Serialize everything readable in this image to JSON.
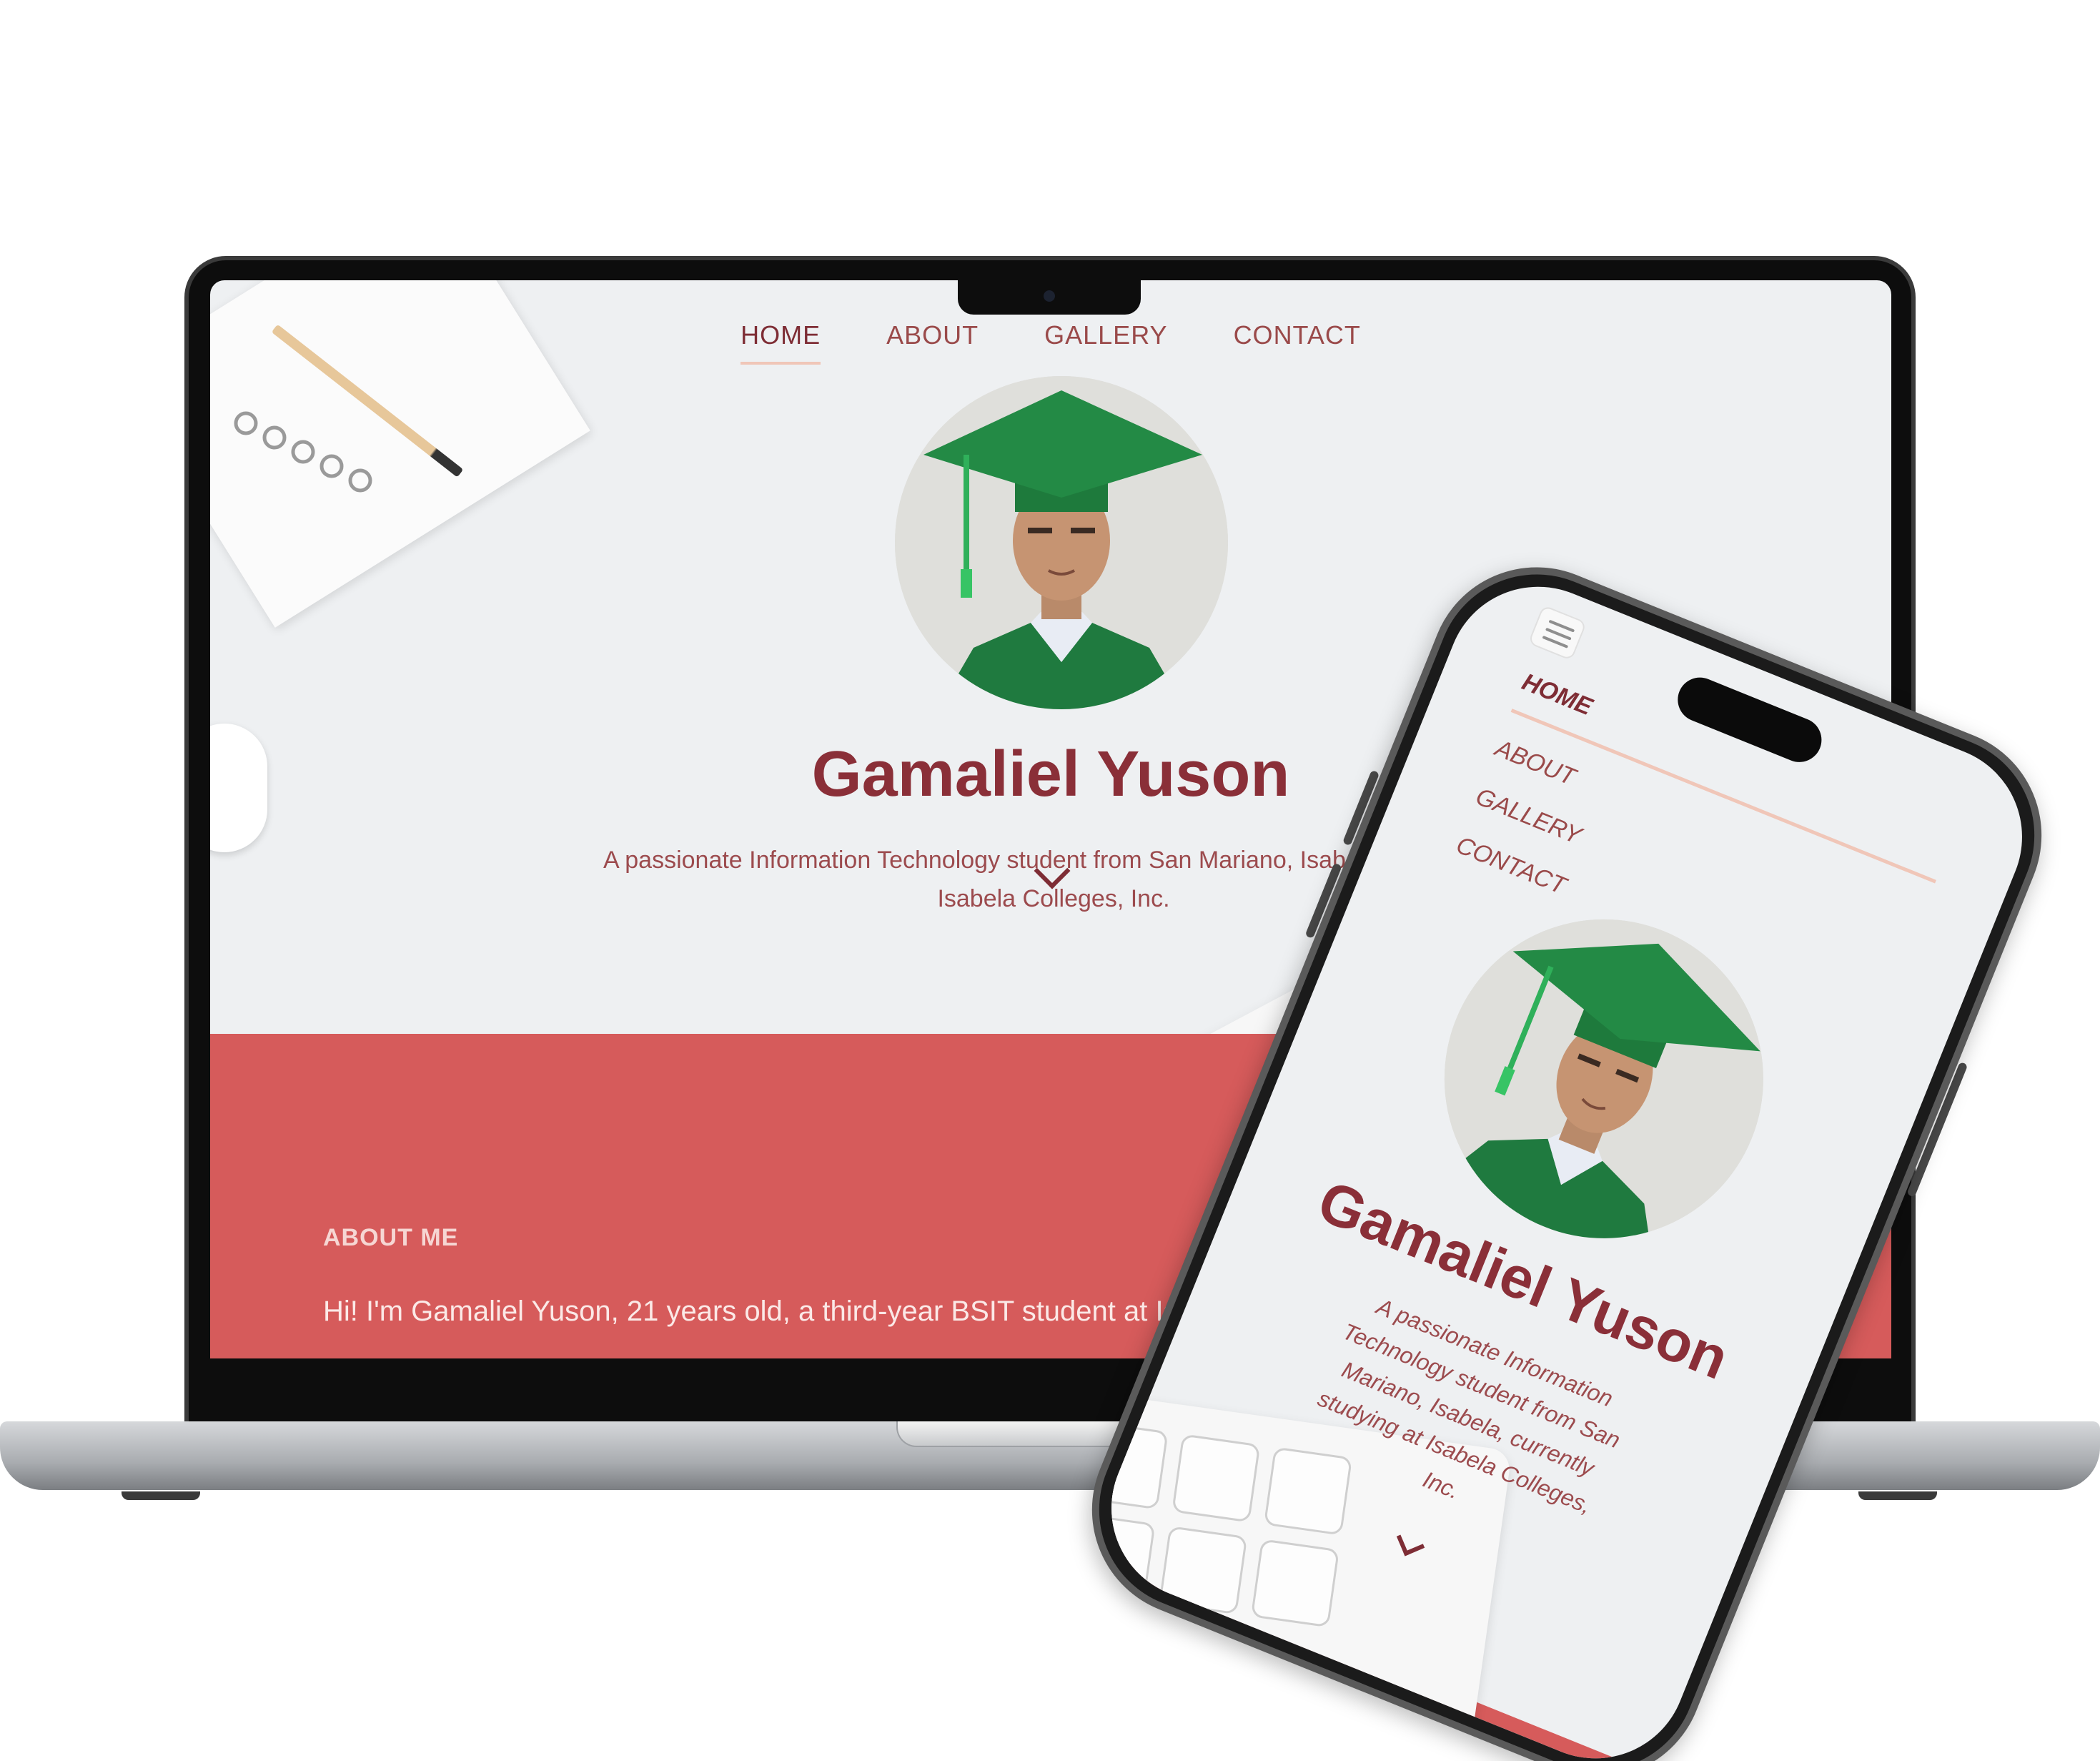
{
  "desktop": {
    "nav": [
      "HOME",
      "ABOUT",
      "GALLERY",
      "CONTACT"
    ],
    "active_nav": "HOME",
    "hero": {
      "name": "Gamaliel Yuson",
      "description_line1": "A passionate Information Technology student from San Mariano, Isabela, currently s",
      "description_line2": "Isabela Colleges, Inc."
    },
    "about": {
      "heading": "ABOUT ME",
      "text": "Hi! I'm Gamaliel Yuson, 21 years old, a third-year BSIT student at Is"
    }
  },
  "mobile": {
    "nav": [
      "HOME",
      "ABOUT",
      "GALLERY",
      "CONTACT"
    ],
    "active_nav": "HOME",
    "hero": {
      "name": "Gamaliel Yuson",
      "description_lines": [
        "A passionate Information",
        "Technology student from San",
        "Mariano, Isabela, currently",
        "studying at Isabela Colleges,",
        "Inc."
      ]
    }
  },
  "colors": {
    "accent": "#d65b5b",
    "title": "#8a2f38",
    "nav_underline": "#f0c6b8",
    "cap_green": "#1e7a3c"
  },
  "icons": [
    "menu-icon",
    "chevron-down-icon"
  ]
}
